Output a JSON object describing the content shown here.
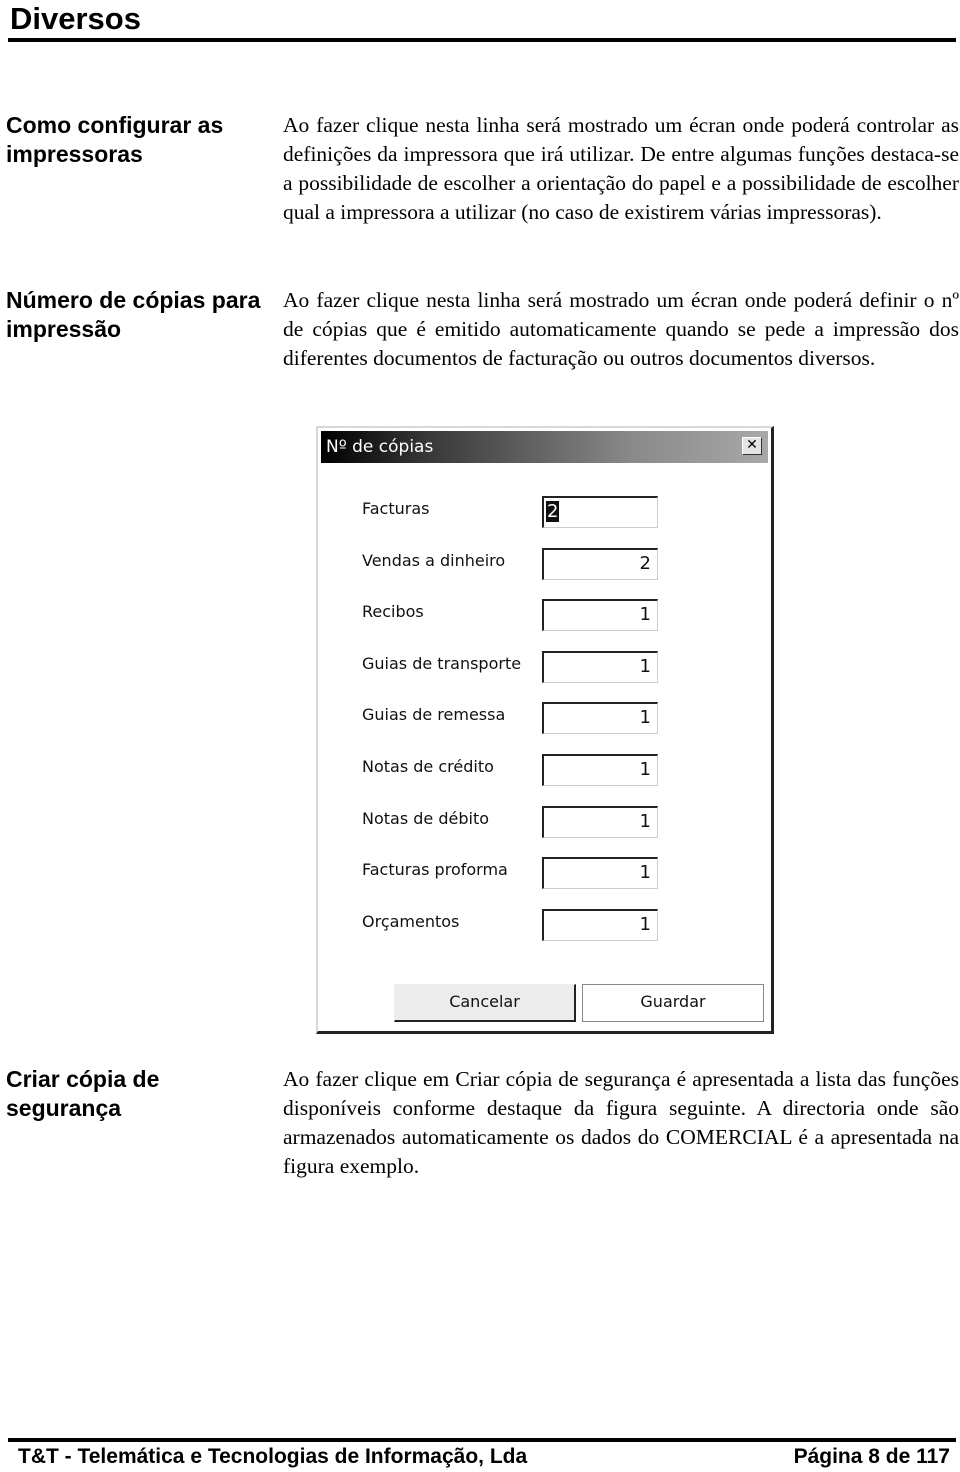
{
  "page": {
    "title": "Diversos"
  },
  "sections": [
    {
      "label": "Como configurar as impressoras",
      "body": "Ao fazer clique nesta linha será mostrado um écran onde poderá controlar as definições da impressora que irá utilizar. De entre algumas funções destaca-se a possibilidade de escolher a orientação do papel e a possibilidade de escolher qual a impressora a utilizar (no caso de existirem várias impressoras)."
    },
    {
      "label": "Número de cópias para impressão",
      "body": "Ao fazer clique nesta linha será mostrado um écran onde poderá definir o nº de cópias que é emitido automaticamente quando se pede a impressão dos diferentes documentos de facturação ou outros documentos diversos."
    },
    {
      "label": "Criar cópia de segurança",
      "body": "Ao fazer clique em Criar cópia de segurança é apresentada a lista das funções disponíveis conforme destaque da figura seguinte. A directoria onde são armazenados automaticamente os dados do COMERCIAL é a apresentada na figura exemplo."
    }
  ],
  "dialog": {
    "title": "Nº de cópias",
    "close_icon": "close-icon",
    "fields": [
      {
        "label": "Facturas",
        "value": "2"
      },
      {
        "label": "Vendas a dinheiro",
        "value": "2"
      },
      {
        "label": "Recibos",
        "value": "1"
      },
      {
        "label": "Guias de transporte",
        "value": "1"
      },
      {
        "label": "Guias de remessa",
        "value": "1"
      },
      {
        "label": "Notas de crédito",
        "value": "1"
      },
      {
        "label": "Notas de débito",
        "value": "1"
      },
      {
        "label": "Facturas proforma",
        "value": "1"
      },
      {
        "label": "Orçamentos",
        "value": "1"
      }
    ],
    "cancel_label": "Cancelar",
    "save_label": "Guardar"
  },
  "footer": {
    "company": "T&T - Telemática e Tecnologias de Informação, Lda",
    "page_info": "Página 8 de 117"
  }
}
